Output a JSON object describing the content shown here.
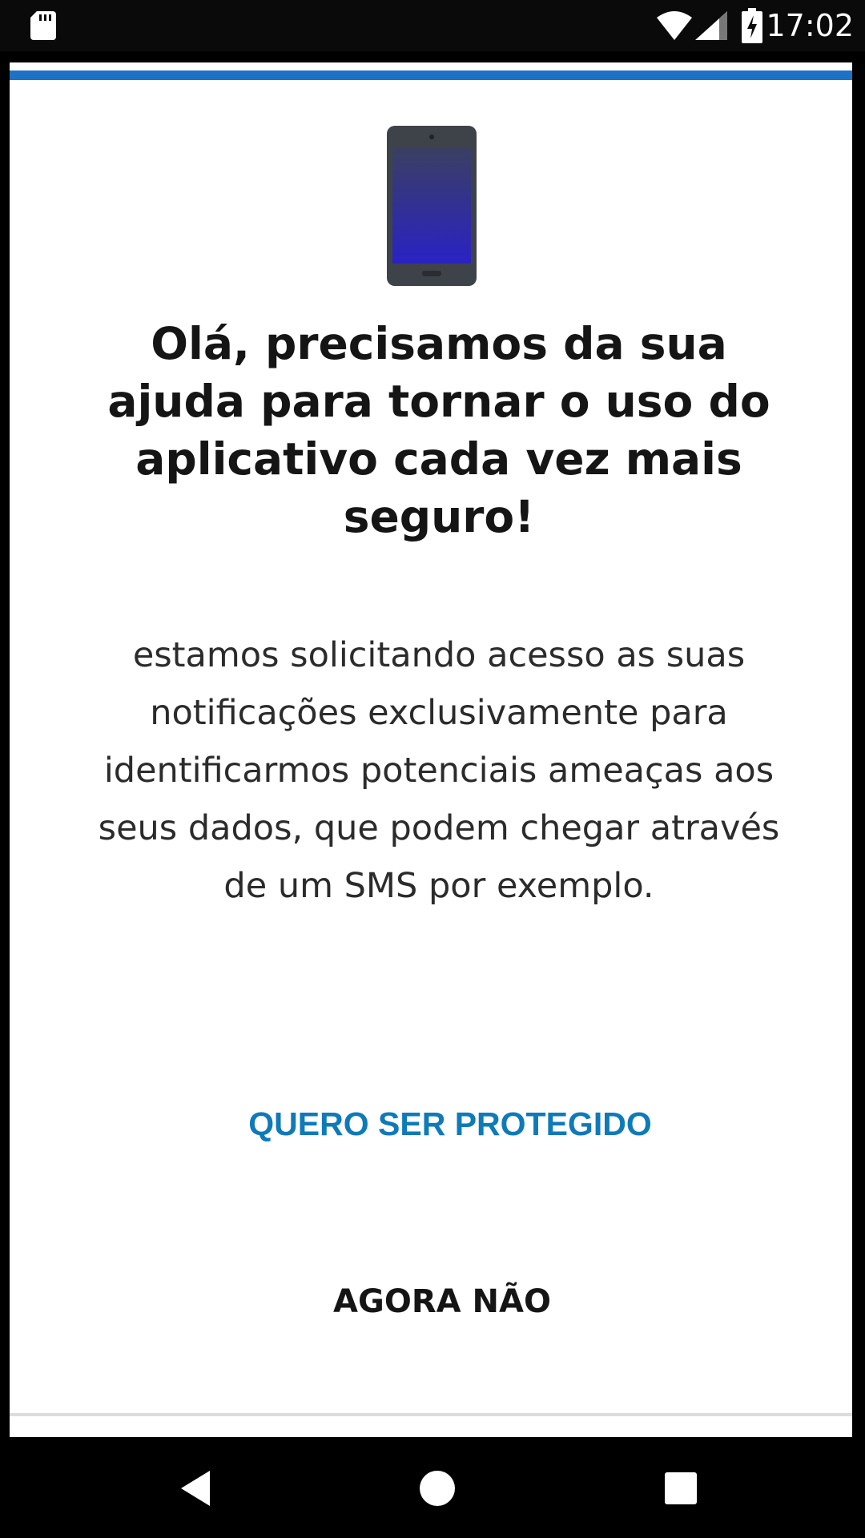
{
  "status_bar": {
    "time": "17:02",
    "icons": [
      "sd-card-icon",
      "wifi-icon",
      "signal-icon",
      "battery-charging-icon"
    ]
  },
  "dialog": {
    "accent_color": "#1e72c6",
    "illustration": "smartphone-icon",
    "title": "Olá, precisamos da sua ajuda para tornar o uso do aplicativo cada vez mais seguro!",
    "message": "estamos solicitando acesso as suas notificações exclusivamente para identificarmos potenciais ameaças aos seus dados, que podem chegar através de um SMS por exemplo.",
    "confirm_label": "QUERO SER PROTEGIDO",
    "confirm_color": "#0f7ab8",
    "dismiss_label": "AGORA NÃO"
  },
  "nav_bar": {
    "buttons": [
      "back-icon",
      "home-icon",
      "recents-icon"
    ]
  }
}
